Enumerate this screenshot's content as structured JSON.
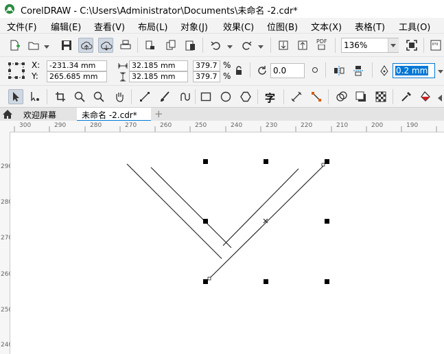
{
  "window": {
    "title": "CorelDRAW - C:\\Users\\Administrator\\Documents\\未命名 -2.cdr*"
  },
  "menu": [
    "文件(F)",
    "编辑(E)",
    "查看(V)",
    "布局(L)",
    "对象(J)",
    "效果(C)",
    "位图(B)",
    "文本(X)",
    "表格(T)",
    "工具(O)"
  ],
  "toolbar": {
    "zoom": "136%",
    "pdf_label": "PDF"
  },
  "properties": {
    "x_label": "X:",
    "y_label": "Y:",
    "x_value": "-231.34 mm",
    "y_value": "265.685 mm",
    "width_value": "32.185 mm",
    "height_value": "32.185 mm",
    "scale_x": "379.7",
    "scale_y": "379.7",
    "percent_x": "%",
    "percent_y": "%",
    "rotation": "0.0",
    "outline_width": "0.2 mm"
  },
  "toolbox": {
    "text_tool_glyph": "字"
  },
  "tabs": {
    "welcome": "欢迎屏幕",
    "document": "未命名 -2.cdr*",
    "add": "+"
  },
  "rulers": {
    "horizontal": [
      "300",
      "290",
      "280",
      "270",
      "260",
      "250",
      "240",
      "230",
      "220",
      "210",
      "200",
      "190"
    ],
    "vertical": [
      "290",
      "280",
      "270",
      "260",
      "250",
      "240"
    ]
  },
  "colors": {
    "selection": "#cfd8e2",
    "accent": "#0078d7",
    "canvas": "#ffffff",
    "chrome": "#f3f3f3"
  }
}
